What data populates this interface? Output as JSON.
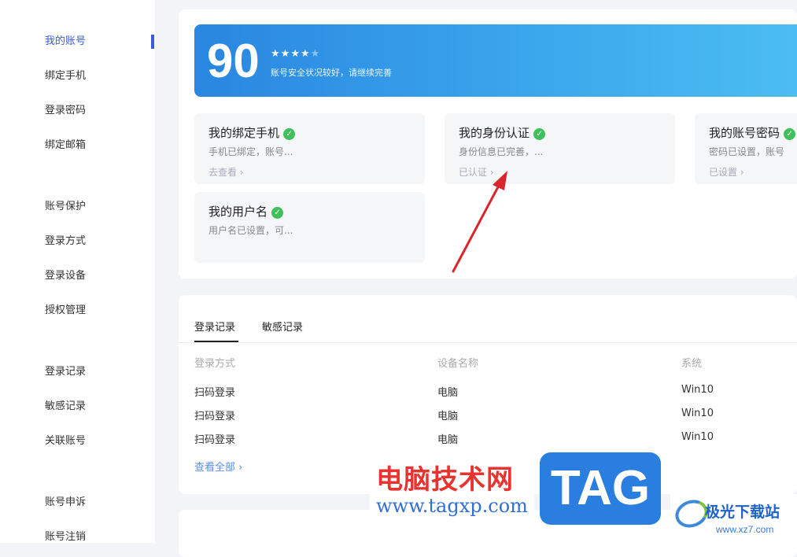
{
  "sidebar": {
    "items": [
      {
        "label": "我的账号",
        "active": true
      },
      {
        "label": "绑定手机"
      },
      {
        "label": "登录密码"
      },
      {
        "label": "绑定邮箱"
      },
      {
        "label": "账号保护"
      },
      {
        "label": "登录方式"
      },
      {
        "label": "登录设备"
      },
      {
        "label": "授权管理"
      },
      {
        "label": "登录记录"
      },
      {
        "label": "敏感记录"
      },
      {
        "label": "关联账号"
      },
      {
        "label": "账号申诉"
      },
      {
        "label": "账号注销"
      }
    ]
  },
  "security": {
    "score": "90",
    "stars_filled": 4,
    "stars_total": 5,
    "description": "账号安全状况较好，请继续完善",
    "banner_color": "#2a86e0"
  },
  "items": [
    {
      "title": "我的绑定手机",
      "desc": "手机已绑定，账号...",
      "link": "去查看 ›"
    },
    {
      "title": "我的身份认证",
      "desc": "身份信息已完善，...",
      "link": "已认证 ›"
    },
    {
      "title": "我的账号密码",
      "desc": "密码已设置，账号",
      "link": "已设置 ›"
    },
    {
      "title": "我的用户名",
      "desc": "用户名已设置，可...",
      "link": ""
    }
  ],
  "records": {
    "tabs": [
      "登录记录",
      "敏感记录"
    ],
    "columns": [
      "登录方式",
      "设备名称",
      "系统"
    ],
    "rows": [
      [
        "扫码登录",
        "电脑",
        "Win10"
      ],
      [
        "扫码登录",
        "电脑",
        "Win10"
      ],
      [
        "扫码登录",
        "电脑",
        "Win10"
      ]
    ],
    "view_all": "查看全部 ›"
  },
  "watermark": {
    "site_name": "电脑技术网",
    "site_url": "www.tagxp.com",
    "tag": "TAG",
    "brand": "极光下载站",
    "brand_url": "www.xz7.com"
  },
  "colors": {
    "accent": "#3b5bdb",
    "check": "#3fc05a",
    "annotation_arrow": "#d9262c"
  }
}
